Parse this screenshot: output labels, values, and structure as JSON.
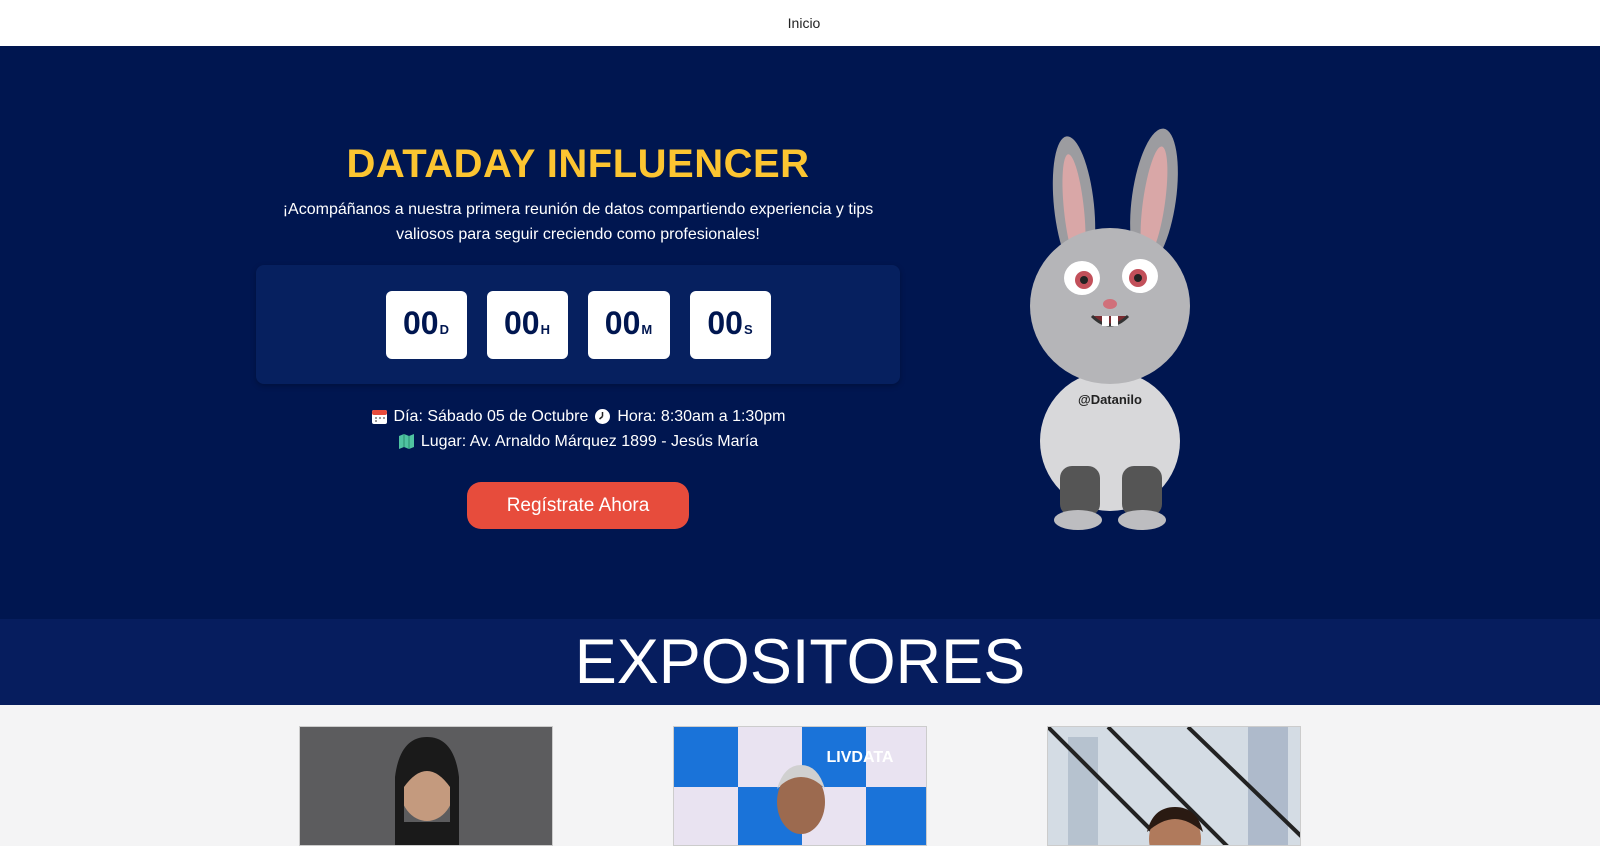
{
  "nav": {
    "home_label": "Inicio"
  },
  "hero": {
    "title": "DATADAY INFLUENCER",
    "subtitle": "¡Acompáñanos a nuestra primera reunión de datos compartiendo experiencia y tips valiosos para seguir creciendo como profesionales!",
    "countdown": [
      {
        "value": "00",
        "unit": "D"
      },
      {
        "value": "00",
        "unit": "H"
      },
      {
        "value": "00",
        "unit": "M"
      },
      {
        "value": "00",
        "unit": "S"
      }
    ],
    "date_text": "Día: Sábado 05 de Octubre",
    "time_text": "Hora: 8:30am a 1:30pm",
    "place_text": "Lugar: Av. Arnaldo Márquez 1899 - Jesús María",
    "cta_label": "Regístrate Ahora",
    "mascot_hoodie_text": "@Datanilo"
  },
  "speakers": {
    "title": "EXPOSITORES",
    "banner_text": "LIVDATA"
  },
  "colors": {
    "hero_bg": "#001650",
    "accent_yellow": "#fcc531",
    "cta_red": "#e74c3c",
    "section_bg": "#061d5e"
  }
}
